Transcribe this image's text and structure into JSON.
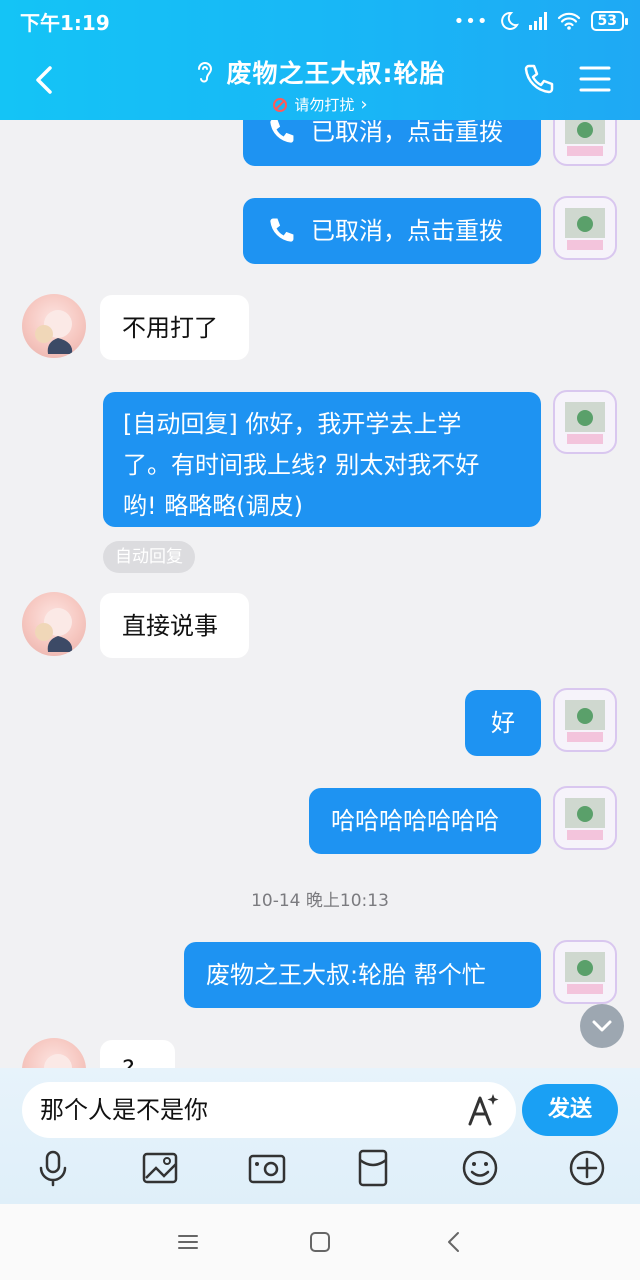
{
  "status_bar": {
    "time": "下午1:19",
    "battery": "53"
  },
  "header": {
    "title": "废物之王大叔:轮胎",
    "subtitle": "请勿打扰",
    "subtitle_chevron": "›"
  },
  "messages": [
    {
      "id": "m1",
      "sender": "me",
      "text": "已取消，点击重拨",
      "icon": "phone-icon"
    },
    {
      "id": "m2",
      "sender": "me",
      "text": "已取消，点击重拨",
      "icon": "phone-icon"
    },
    {
      "id": "m3",
      "sender": "them",
      "text": "不用打了"
    },
    {
      "id": "m4",
      "sender": "me",
      "lines": [
        "[自动回复] 你好，我开学去上学",
        "了。有时间我上线? 别太对我不好",
        "哟! 略略略(调皮)"
      ],
      "tag": "自动回复"
    },
    {
      "id": "m5",
      "sender": "them",
      "text": "直接说事"
    },
    {
      "id": "m6",
      "sender": "me",
      "text": "好"
    },
    {
      "id": "m7",
      "sender": "me",
      "text": "哈哈哈哈哈哈哈"
    },
    {
      "id": "ts",
      "timestamp": "10-14 晚上10:13"
    },
    {
      "id": "m8",
      "sender": "me",
      "text": "废物之王大叔:轮胎 帮个忙"
    },
    {
      "id": "m9",
      "sender": "them",
      "text": "?"
    }
  ],
  "input": {
    "value": "那个人是不是你",
    "send_label": "发送"
  },
  "toolbar": [
    "mic-icon",
    "image-icon",
    "camera-icon",
    "red-packet-icon",
    "emoji-icon",
    "plus-icon"
  ],
  "colors": {
    "header": "#19b5f6",
    "my_bubble": "#1e93f2",
    "their_bubble": "#ffffff",
    "background": "#f1f1f3"
  }
}
